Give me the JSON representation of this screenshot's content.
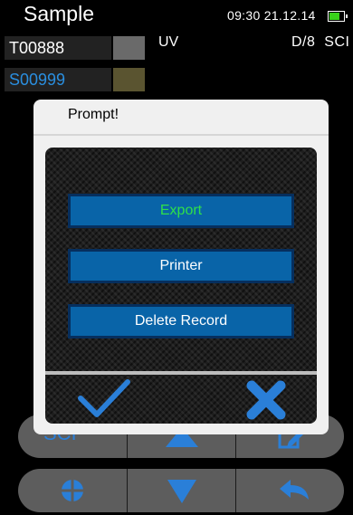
{
  "header": {
    "title": "Sample",
    "time": "09:30",
    "date": "21.12.14"
  },
  "samples": [
    {
      "id": "T00888",
      "swatch_color": "#6a6a6a",
      "text_color": "#ffffff"
    },
    {
      "id": "S00999",
      "swatch_color": "#5a5430",
      "text_color": "#2a8fe0"
    }
  ],
  "measurement": {
    "light_source": "UV",
    "geometry": "D/8",
    "mode": "SCI"
  },
  "bottom_nav": {
    "row1": {
      "mode_label": "SCI"
    }
  },
  "dialog": {
    "title": "Prompt!",
    "buttons": [
      "Export",
      "Printer",
      "Delete Record"
    ],
    "confirm_icon": "check-icon",
    "cancel_icon": "close-icon"
  },
  "colors": {
    "accent_blue": "#2a7fd8",
    "button_blue": "#0964a8",
    "export_green": "#2fe04a",
    "battery_green": "#39d11b"
  }
}
